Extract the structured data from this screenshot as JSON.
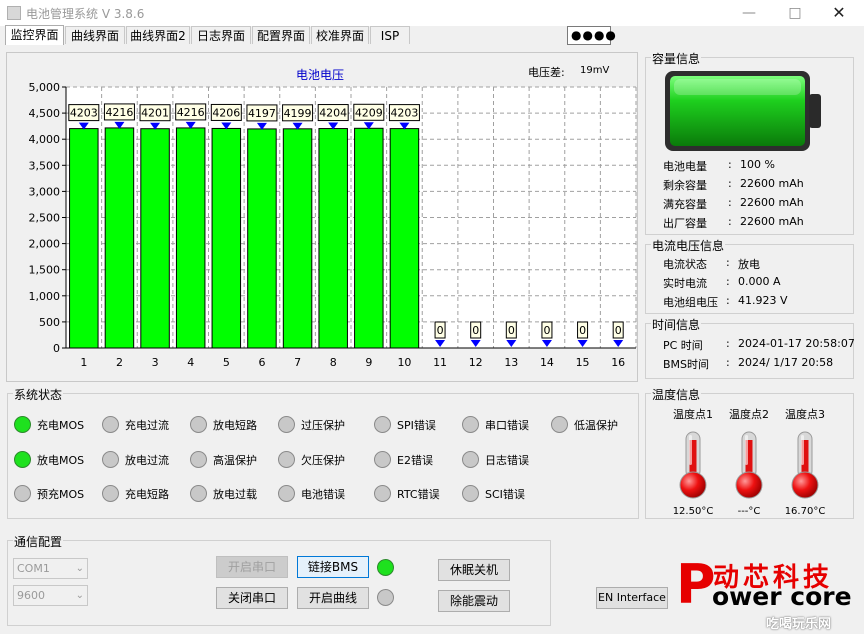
{
  "window": {
    "title": "电池管理系统 V 3.8.6"
  },
  "tabs": [
    "监控界面",
    "曲线界面",
    "曲线界面2",
    "日志界面",
    "配置界面",
    "校准界面",
    "ISP"
  ],
  "password_mask": "●●●●",
  "chart": {
    "title": "电池电压",
    "diff_label": "电压差:",
    "diff_value": "19mV"
  },
  "chart_data": {
    "type": "bar",
    "title": "电池电压",
    "categories": [
      "1",
      "2",
      "3",
      "4",
      "5",
      "6",
      "7",
      "8",
      "9",
      "10",
      "11",
      "12",
      "13",
      "14",
      "15",
      "16"
    ],
    "values": [
      4203,
      4216,
      4201,
      4216,
      4206,
      4197,
      4199,
      4204,
      4209,
      4203,
      0,
      0,
      0,
      0,
      0,
      0
    ],
    "ylim": [
      0,
      5000
    ],
    "yticks": [
      "0",
      "500",
      "1,000",
      "1,500",
      "2,000",
      "2,500",
      "3,000",
      "3,500",
      "4,000",
      "4,500",
      "5,000"
    ],
    "grid": true,
    "bar_color": "#00ff00",
    "marker_color": "#0000ff"
  },
  "capacity": {
    "title": "容量信息",
    "rows": [
      {
        "label": "电池电量",
        "value": "100 %"
      },
      {
        "label": "剩余容量",
        "value": "22600 mAh"
      },
      {
        "label": "满充容量",
        "value": "22600 mAh"
      },
      {
        "label": "出厂容量",
        "value": "22600 mAh"
      }
    ],
    "level_percent": 100
  },
  "current": {
    "title": "电流电压信息",
    "rows": [
      {
        "label": "电流状态",
        "value": "放电"
      },
      {
        "label": "实时电流",
        "value": "0.000 A"
      },
      {
        "label": "电池组电压",
        "value": "41.923 V"
      }
    ]
  },
  "time": {
    "title": "时间信息",
    "rows": [
      {
        "label": "PC 时间",
        "value": "2024-01-17 20:58:07"
      },
      {
        "label": "BMS时间",
        "value": "2024/ 1/17 20:58"
      }
    ]
  },
  "temperature": {
    "title": "温度信息",
    "points": [
      {
        "label": "温度点1",
        "value": "12.50°C"
      },
      {
        "label": "温度点2",
        "value": "---°C"
      },
      {
        "label": "温度点3",
        "value": "16.70°C"
      }
    ]
  },
  "system_status": {
    "title": "系统状态",
    "items": [
      {
        "label": "充电MOS",
        "on": true
      },
      {
        "label": "充电过流",
        "on": false
      },
      {
        "label": "放电短路",
        "on": false
      },
      {
        "label": "过压保护",
        "on": false
      },
      {
        "label": "SPI错误",
        "on": false
      },
      {
        "label": "串口错误",
        "on": false
      },
      {
        "label": "低温保护",
        "on": false
      },
      {
        "label": "放电MOS",
        "on": true
      },
      {
        "label": "放电过流",
        "on": false
      },
      {
        "label": "高温保护",
        "on": false
      },
      {
        "label": "欠压保护",
        "on": false
      },
      {
        "label": "E2错误",
        "on": false
      },
      {
        "label": "日志错误",
        "on": false
      },
      {
        "label": "预充MOS",
        "on": false
      },
      {
        "label": "充电短路",
        "on": false
      },
      {
        "label": "放电过载",
        "on": false
      },
      {
        "label": "电池错误",
        "on": false
      },
      {
        "label": "RTC错误",
        "on": false
      },
      {
        "label": "SCI错误",
        "on": false
      }
    ]
  },
  "comm": {
    "title": "通信配置",
    "port": "COM1",
    "baud": "9600",
    "open_port": "开启串口",
    "close_port": "关闭串口",
    "link_bms": "链接BMS",
    "open_curve": "开启曲线",
    "sleep_shutdown": "休眠关机",
    "wake_vibrate": "除能震动",
    "link_led_on": true,
    "curve_led_on": false
  },
  "language_button": "EN Interface",
  "brand": {
    "line1": "动芯科技",
    "line2": "ower core",
    "initial": "P",
    "watermark": "吃喝玩乐网"
  },
  "colors": {
    "bar": "#00ff00",
    "led_on": "#1ee11e",
    "brand_red": "#e60000",
    "chart_title": "#0000cc"
  }
}
